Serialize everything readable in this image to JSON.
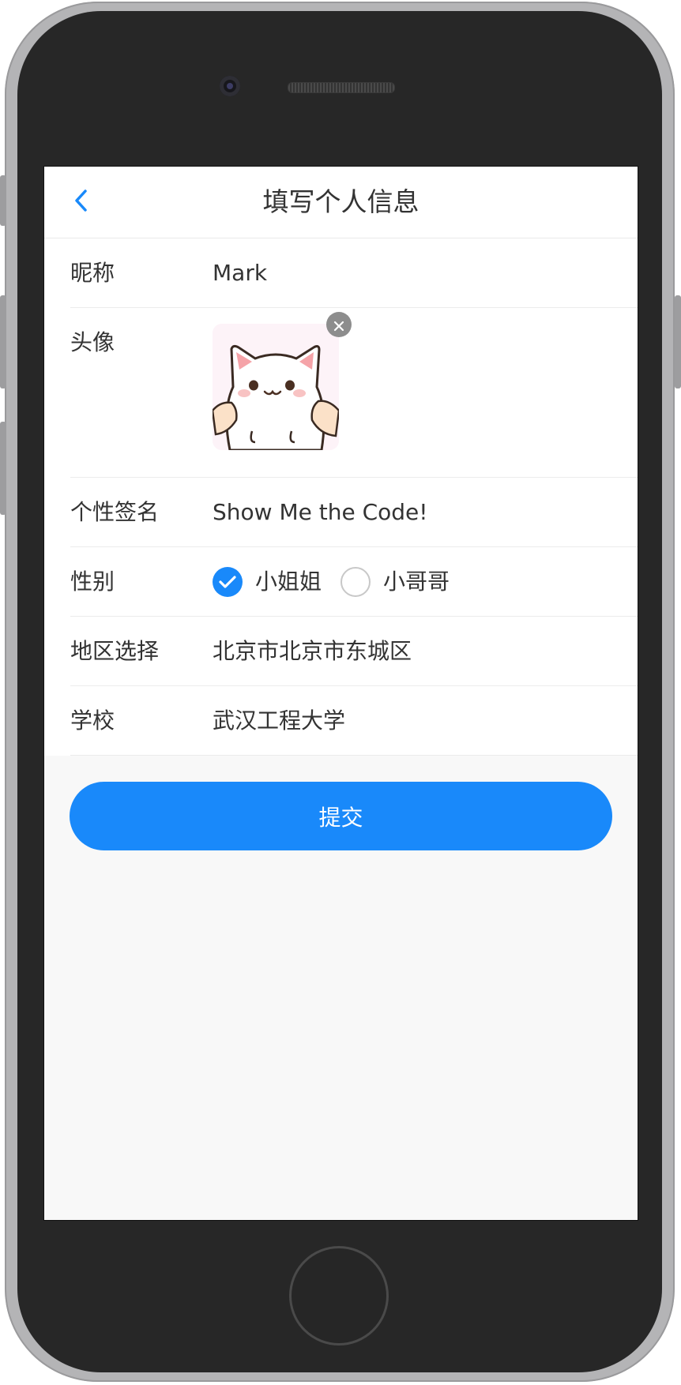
{
  "nav": {
    "title": "填写个人信息",
    "back_icon": "chevron-left-icon"
  },
  "form": {
    "nickname": {
      "label": "昵称",
      "value": "Mark"
    },
    "avatar": {
      "label": "头像",
      "image": "cat-avatar",
      "remove_icon": "close-icon"
    },
    "signature": {
      "label": "个性签名",
      "value": "Show Me the Code!"
    },
    "gender": {
      "label": "性别",
      "options": [
        {
          "label": "小姐姐",
          "checked": true
        },
        {
          "label": "小哥哥",
          "checked": false
        }
      ]
    },
    "region": {
      "label": "地区选择",
      "value": "北京市北京市东城区"
    },
    "school": {
      "label": "学校",
      "value": "武汉工程大学"
    }
  },
  "submit": {
    "label": "提交"
  },
  "colors": {
    "accent": "#1989fa",
    "text": "#333333",
    "background": "#f8f8f8"
  }
}
